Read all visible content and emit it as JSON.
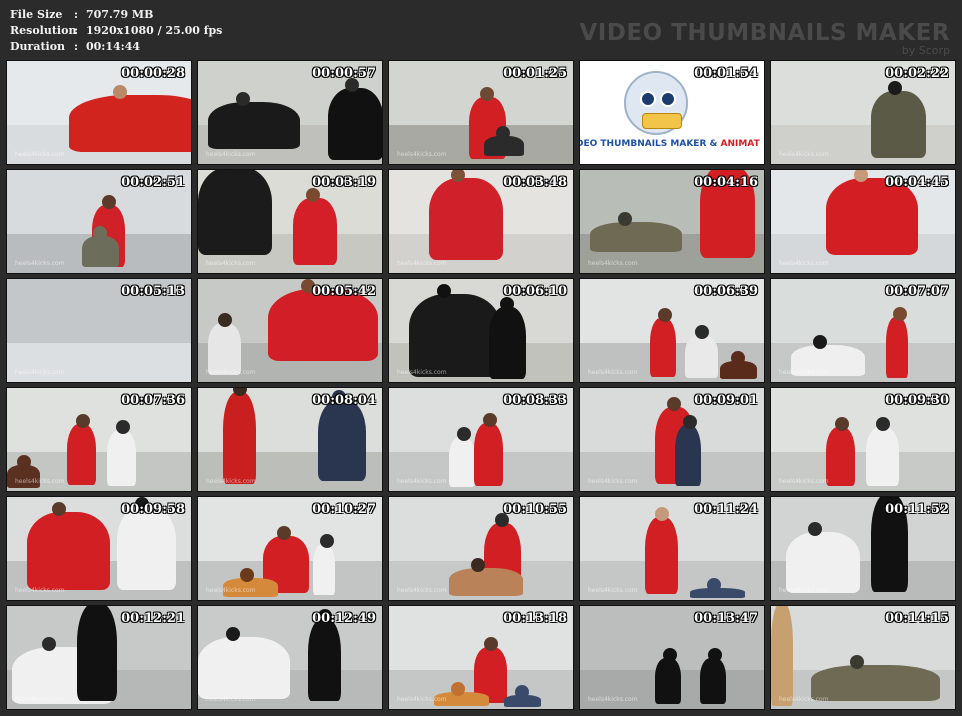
{
  "info": {
    "file_size_label": "File Size",
    "file_size": "707.79 MB",
    "resolution_label": "Resolution",
    "resolution": "1920x1080 / 25.00 fps",
    "duration_label": "Duration",
    "duration": "00:14:44",
    "separator": ":"
  },
  "brand": {
    "title": "VIDEO THUMBNAILS MAKER",
    "subtitle": "by Scorp"
  },
  "watermark": "heels4kicks.com",
  "logo": {
    "text_blue": "DEO THUMBNAILS MAKER",
    "text_amp": " & ",
    "text_red": "ANIMAT"
  },
  "thumbnails": [
    {
      "time": "00:00:28",
      "wall": "#e6e9ec",
      "floor": "#d9dcdf",
      "figs": [
        [
          "#d2241f",
          62,
          "55%",
          "80%",
          48,
          "#b88a6a"
        ]
      ]
    },
    {
      "time": "00:00:57",
      "wall": "#cfd1cc",
      "floor": "#bfc0bb",
      "figs": [
        [
          "#1a1a1a",
          10,
          "45%",
          "50%",
          60,
          "#2a2a2a"
        ],
        [
          "#111111",
          130,
          "70%",
          "30%",
          14,
          "#2a2a2a"
        ]
      ]
    },
    {
      "time": "00:01:25",
      "wall": "#d3d6d0",
      "floor": "#a7a9a2",
      "figs": [
        [
          "#d11f24",
          80,
          "60%",
          "20%",
          20,
          "#6e4a34"
        ],
        [
          "#2b2b2b",
          95,
          "20%",
          "22%",
          30,
          "#2b2b2b"
        ]
      ]
    },
    {
      "time": "00:01:54",
      "logo": true
    },
    {
      "time": "00:02:22",
      "wall": "#dcdedb",
      "floor": "#cfd0cc",
      "figs": [
        [
          "#5a5a47",
          100,
          "65%",
          "30%",
          22,
          "#1a1a1a"
        ]
      ]
    },
    {
      "time": "00:02:51",
      "wall": "#d8dbdd",
      "floor": "#b9bcbf",
      "figs": [
        [
          "#cf2127",
          85,
          "60%",
          "18%",
          24,
          "#5a3a28"
        ],
        [
          "#6d6d5c",
          75,
          "30%",
          "20%",
          24,
          "#6d6d5c"
        ]
      ]
    },
    {
      "time": "00:03:19",
      "wall": "#dcdcd6",
      "floor": "#c8c8c2",
      "figs": [
        [
          "#1b1b1b",
          0,
          "85%",
          "40%",
          70,
          "#1b1b1b"
        ],
        [
          "#d41e28",
          95,
          "65%",
          "24%",
          30,
          "#7a4a30"
        ]
      ]
    },
    {
      "time": "00:03:48",
      "wall": "#e4e3df",
      "floor": "#d2d1cd",
      "figs": [
        [
          "#d0202a",
          40,
          "80%",
          "40%",
          50,
          "#7d5236"
        ]
      ]
    },
    {
      "time": "00:04:16",
      "wall": "#b9bdb7",
      "floor": "#9ea19a",
      "figs": [
        [
          "#6e6a53",
          10,
          "30%",
          "50%",
          80,
          "#3a3a30"
        ],
        [
          "#d11f24",
          120,
          "90%",
          "30%",
          60,
          "#b88a6a"
        ]
      ]
    },
    {
      "time": "00:04:45",
      "wall": "#e4e7ea",
      "floor": "#d5d8db",
      "figs": [
        [
          "#d31f23",
          55,
          "75%",
          "50%",
          70,
          "#c49a7a"
        ]
      ]
    },
    {
      "time": "00:05:13",
      "wall": "#c4c7ca",
      "floor": "#dcdfe2",
      "figs": []
    },
    {
      "time": "00:05:42",
      "wall": "#c7c9c6",
      "floor": "#b2b4b1",
      "figs": [
        [
          "#e6e6e6",
          10,
          "50%",
          "18%",
          28,
          "#3a2a20"
        ],
        [
          "#d21f27",
          70,
          "70%",
          "60%",
          80,
          "#7a4a30"
        ]
      ]
    },
    {
      "time": "00:06:10",
      "wall": "#d8d8d4",
      "floor": "#c2c2bd",
      "figs": [
        [
          "#1a1a1a",
          20,
          "80%",
          "50%",
          20,
          "#111"
        ],
        [
          "#111111",
          100,
          "70%",
          "20%",
          10,
          "#111"
        ]
      ]
    },
    {
      "time": "00:06:39",
      "wall": "#e2e4e3",
      "floor": "#bfc1c0",
      "figs": [
        [
          "#d11f24",
          70,
          "58%",
          "14%",
          18,
          "#5a3a28"
        ],
        [
          "#e9e9e9",
          105,
          "42%",
          "18%",
          16,
          "#2b2b2b"
        ],
        [
          "#5a2a1a",
          140,
          "18%",
          "20%",
          10,
          "#5a2a1a"
        ]
      ]
    },
    {
      "time": "00:07:07",
      "wall": "#d9dedc",
      "floor": "#c5c8c6",
      "figs": [
        [
          "#efefef",
          20,
          "30%",
          "40%",
          22,
          "#1a1a1a"
        ],
        [
          "#d11f24",
          115,
          "60%",
          "12%",
          14,
          "#7a4a30"
        ]
      ]
    },
    {
      "time": "00:07:36",
      "wall": "#dfe1df",
      "floor": "#c4c6c4",
      "figs": [
        [
          "#d11f24",
          60,
          "60%",
          "16%",
          22,
          "#5a3a28"
        ],
        [
          "#f0f0f0",
          100,
          "55%",
          "16%",
          18,
          "#2b2b2b"
        ],
        [
          "#5a3020",
          0,
          "22%",
          "18%",
          12,
          "#5a3020"
        ]
      ]
    },
    {
      "time": "00:08:04",
      "wall": "#dcdedb",
      "floor": "#bcbeb9",
      "figs": [
        [
          "#c9201f",
          25,
          "90%",
          "18%",
          26,
          "#3a2a20"
        ],
        [
          "#2a3550",
          120,
          "78%",
          "26%",
          40,
          "#2a3550"
        ]
      ]
    },
    {
      "time": "00:08:33",
      "wall": "#dcdfdd",
      "floor": "#c4c7c5",
      "figs": [
        [
          "#f0f0f0",
          60,
          "48%",
          "14%",
          16,
          "#2b2b2b"
        ],
        [
          "#d11f24",
          85,
          "62%",
          "16%",
          18,
          "#5a3a28"
        ]
      ]
    },
    {
      "time": "00:09:01",
      "wall": "#d8dbd9",
      "floor": "#c2c5c3",
      "figs": [
        [
          "#d11f24",
          75,
          "75%",
          "22%",
          26,
          "#5a3a28"
        ],
        [
          "#2a3550",
          95,
          "60%",
          "14%",
          18,
          "#2b2b2b"
        ]
      ]
    },
    {
      "time": "00:09:30",
      "wall": "#dfe1df",
      "floor": "#c8cac8",
      "figs": [
        [
          "#d11f24",
          55,
          "58%",
          "16%",
          18,
          "#5a3a28"
        ],
        [
          "#f0f0f0",
          95,
          "58%",
          "18%",
          18,
          "#2b2b2b"
        ]
      ]
    },
    {
      "time": "00:09:58",
      "wall": "#dcdedd",
      "floor": "#bfc1c0",
      "figs": [
        [
          "#d11f24",
          20,
          "75%",
          "45%",
          40,
          "#5a3a28"
        ],
        [
          "#f0f0f0",
          110,
          "80%",
          "32%",
          40,
          "#1a1a1a"
        ]
      ]
    },
    {
      "time": "00:10:27",
      "wall": "#e2e4e3",
      "floor": "#c3c5c4",
      "figs": [
        [
          "#d11f24",
          65,
          "55%",
          "25%",
          28,
          "#5a3a28"
        ],
        [
          "#f0f0f0",
          115,
          "50%",
          "12%",
          18,
          "#2b2b2b"
        ],
        [
          "#d48a3a",
          25,
          "18%",
          "30%",
          12,
          "#6b3a1a"
        ]
      ]
    },
    {
      "time": "00:10:55",
      "wall": "#dcdedd",
      "floor": "#c7c9c8",
      "figs": [
        [
          "#d11f24",
          95,
          "70%",
          "20%",
          20,
          "#2b2b2b"
        ],
        [
          "#b98258",
          60,
          "28%",
          "40%",
          14,
          "#3a2a20"
        ]
      ]
    },
    {
      "time": "00:11:24",
      "wall": "#dcdedd",
      "floor": "#c5c7c6",
      "figs": [
        [
          "#d11f24",
          65,
          "75%",
          "18%",
          22,
          "#c49a7a"
        ],
        [
          "#3a4a6a",
          110,
          "10%",
          "30%",
          8,
          "#3a4a6a"
        ]
      ]
    },
    {
      "time": "00:11:52",
      "wall": "#d2d4d3",
      "floor": "#b9bbba",
      "figs": [
        [
          "#f0f0f0",
          15,
          "60%",
          "40%",
          26,
          "#2b2b2b"
        ],
        [
          "#111111",
          100,
          "95%",
          "20%",
          30,
          "#111"
        ]
      ]
    },
    {
      "time": "00:12:21",
      "wall": "#c7c9c8",
      "floor": "#b6b8b7",
      "figs": [
        [
          "#f0f0f0",
          5,
          "55%",
          "55%",
          20,
          "#2b2b2b"
        ],
        [
          "#111111",
          70,
          "95%",
          "22%",
          30,
          "#111"
        ]
      ]
    },
    {
      "time": "00:12:49",
      "wall": "#c9cbca",
      "floor": "#b8bab9",
      "figs": [
        [
          "#f0f0f0",
          0,
          "60%",
          "50%",
          40,
          "#1a1a1a"
        ],
        [
          "#111111",
          110,
          "80%",
          "18%",
          30,
          "#111"
        ]
      ]
    },
    {
      "time": "00:13:18",
      "wall": "#e0e2e1",
      "floor": "#c5c7c6",
      "figs": [
        [
          "#d11f24",
          85,
          "55%",
          "18%",
          22,
          "#5a3a28"
        ],
        [
          "#3a4a6a",
          115,
          "12%",
          "20%",
          8,
          "#3a4a6a"
        ],
        [
          "#d48a3a",
          45,
          "14%",
          "30%",
          10,
          "#c07030"
        ]
      ]
    },
    {
      "time": "00:13:47",
      "wall": "#bcbebd",
      "floor": "#a8aaa9",
      "figs": [
        [
          "#111111",
          75,
          "45%",
          "14%",
          20,
          "#111"
        ],
        [
          "#111111",
          120,
          "45%",
          "14%",
          20,
          "#111"
        ]
      ]
    },
    {
      "time": "00:14:15",
      "wall": "#d9dbda",
      "floor": "#c5c7c6",
      "figs": [
        [
          "#c8a070",
          0,
          "100%",
          "12%",
          10,
          "#c8a070"
        ],
        [
          "#6e6a53",
          40,
          "35%",
          "70%",
          30,
          "#3a3a30"
        ]
      ]
    }
  ]
}
